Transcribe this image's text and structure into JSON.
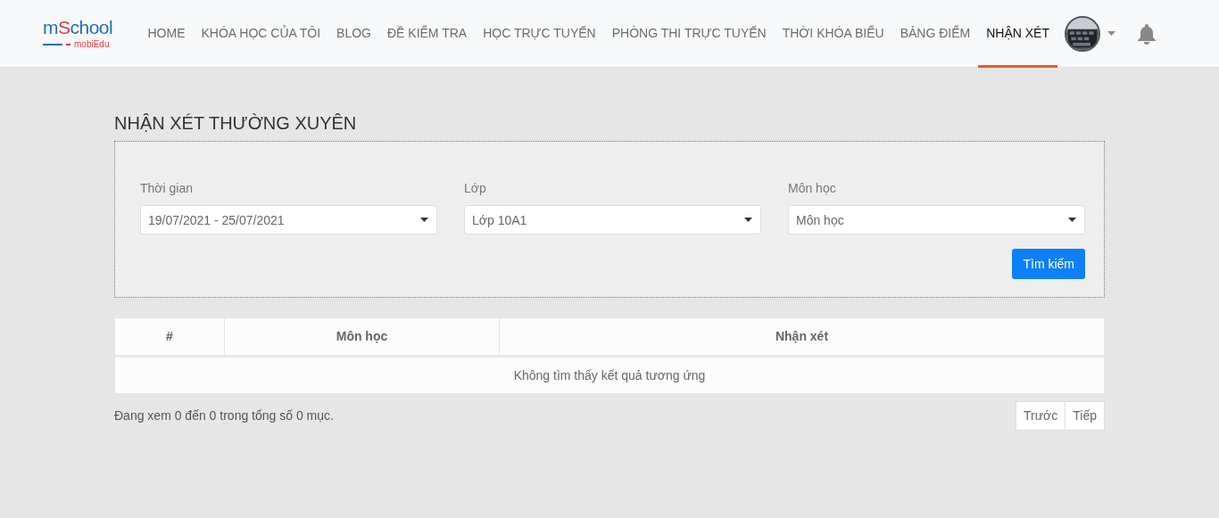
{
  "logo": {
    "parts": [
      {
        "text": "m",
        "color": "#1f6fc1"
      },
      {
        "text": "S",
        "color": "#e03a3e"
      },
      {
        "text": "chool",
        "color": "#1f6fc1"
      }
    ],
    "tagline": "mobiEdu"
  },
  "nav": [
    {
      "label": "HOME",
      "selected": false
    },
    {
      "label": "KHÓA HỌC CỦA TÔI",
      "selected": false
    },
    {
      "label": "BLOG",
      "selected": false
    },
    {
      "label": "ĐỀ KIỂM TRA",
      "selected": false
    },
    {
      "label": "HỌC TRỰC TUYẾN",
      "selected": false
    },
    {
      "label": "PHÒNG THI TRỰC TUYẾN",
      "selected": false
    },
    {
      "label": "THỜI KHÓA BIỂU",
      "selected": false
    },
    {
      "label": "BẢNG ĐIỂM",
      "selected": false
    },
    {
      "label": "NHẬN XÉT",
      "selected": true
    }
  ],
  "user": {
    "avatar": {
      "kind": "picture"
    }
  },
  "page_title": "NHẬN XÉT THƯỜNG XUYÊN",
  "filters": [
    {
      "label": "Thời gian",
      "value": "19/07/2021 - 25/07/2021"
    },
    {
      "label": "Lớp",
      "value": "Lớp 10A1"
    },
    {
      "label": "Môn học",
      "placeholder": "Môn học"
    }
  ],
  "search_button": "Tìm kiếm",
  "table": {
    "columns": [
      "#",
      "Môn học",
      "Nhận xét"
    ],
    "empty_message": "Không tìm thấy kết quả tương ứng"
  },
  "summary": "Đang xem 0 đến 0 trong tổng số 0 mục.",
  "pagination": [
    "Trước",
    "Tiếp"
  ]
}
